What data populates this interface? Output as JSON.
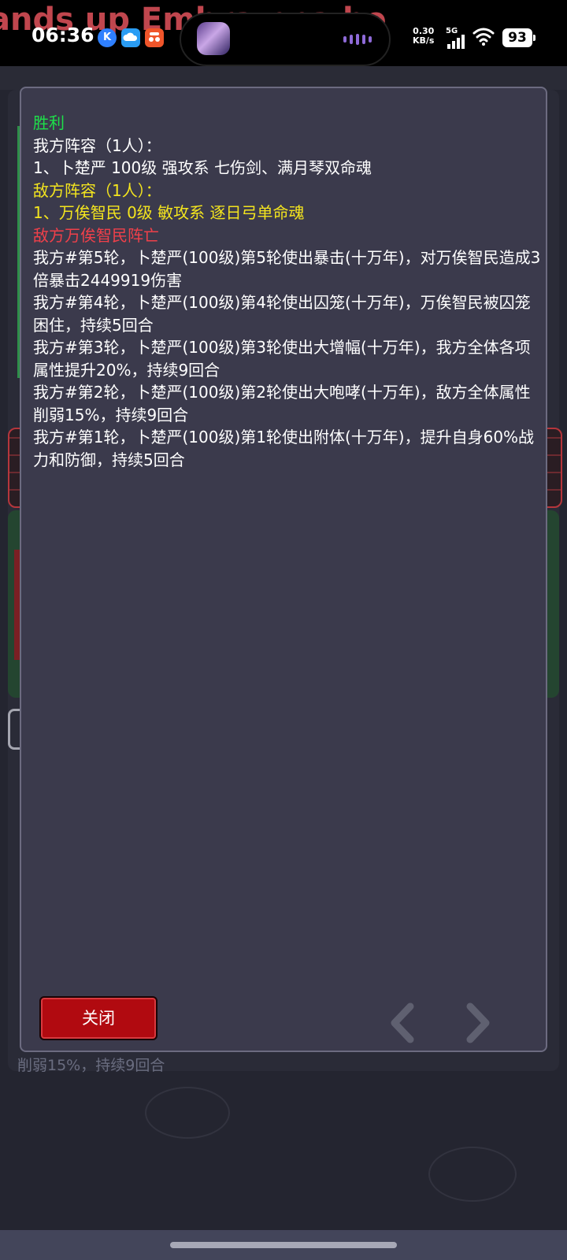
{
  "status_bar": {
    "lyric": "ands up Embra      nna be",
    "time": "06:36",
    "net_speed_value": "0.30",
    "net_speed_unit": "KB/s",
    "network": "5G",
    "battery": "93",
    "app_badge_k": "K"
  },
  "background": {
    "partial_text": "削弱15%，持续9回合"
  },
  "dialog": {
    "result": "胜利",
    "our_lineup_title": "我方阵容（1人）：",
    "our_lineup_item": "1、卜楚严 100级 强攻系 七伤剑、满月琴双命魂",
    "enemy_lineup_title": "敌方阵容（1人）：",
    "enemy_lineup_item": "1、万俟智民 0级 敏攻系 逐日弓单命魂",
    "enemy_defeated": "敌方万俟智民阵亡",
    "log_entries": [
      "我方#第5轮，卜楚严(100级)第5轮使出暴击(十万年)，对万俟智民造成3倍暴击2449919伤害",
      "我方#第4轮，卜楚严(100级)第4轮使出囚笼(十万年)，万俟智民被囚笼困住，持续5回合",
      "我方#第3轮，卜楚严(100级)第3轮使出大增幅(十万年)，我方全体各项属性提升20%，持续9回合",
      "我方#第2轮，卜楚严(100级)第2轮使出大咆哮(十万年)，敌方全体属性削弱15%，持续9回合",
      "我方#第1轮，卜楚严(100级)第1轮使出附体(十万年)，提升自身60%战力和防御，持续5回合"
    ],
    "close_label": "关闭"
  }
}
